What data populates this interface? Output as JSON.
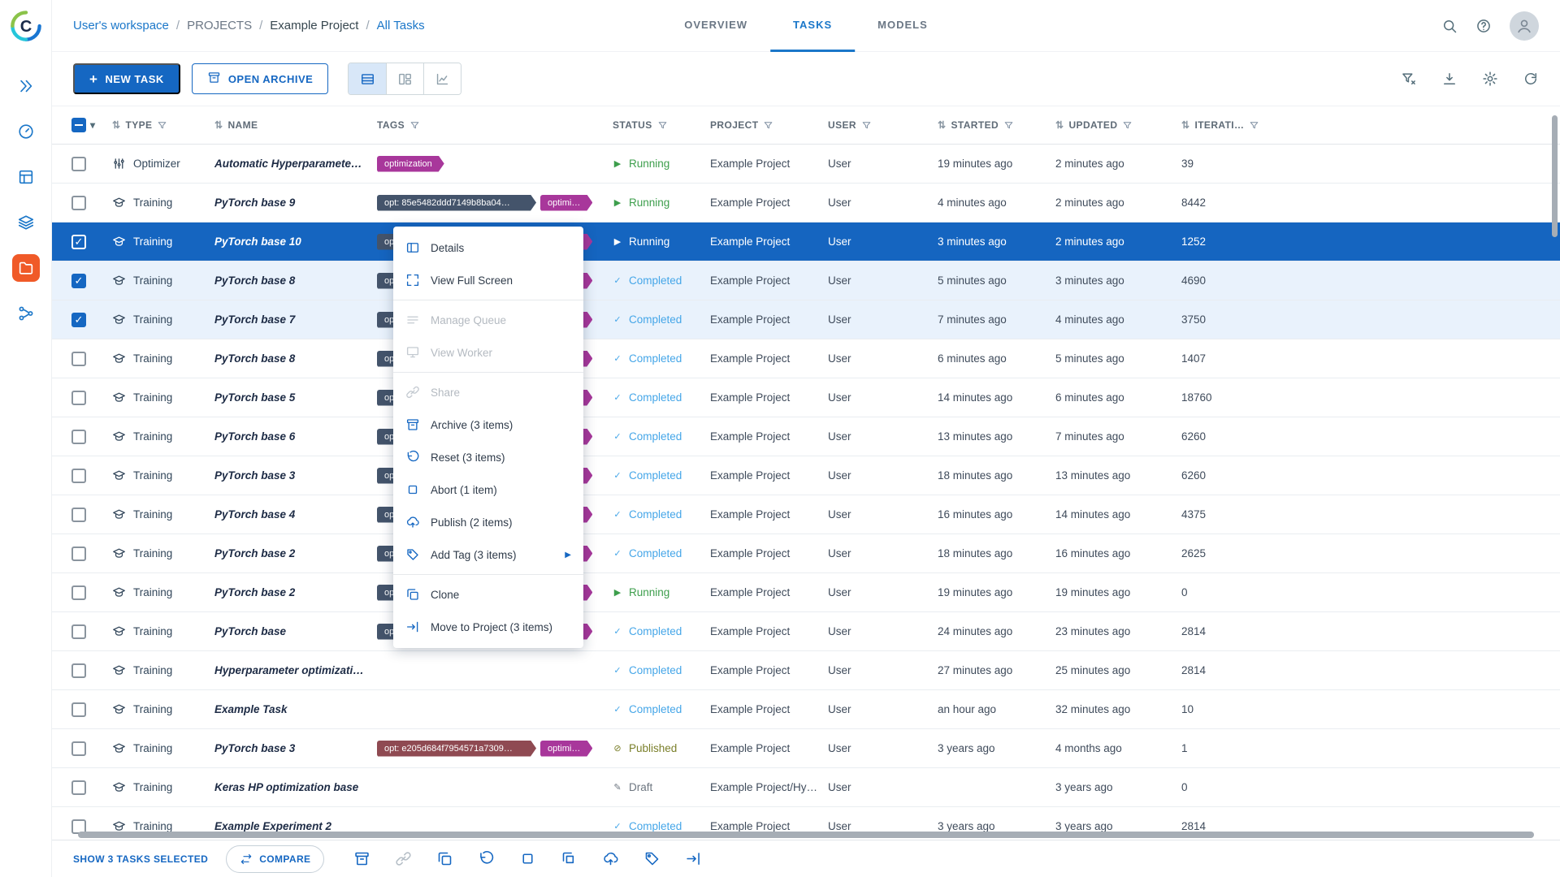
{
  "colors": {
    "primary": "#1567c2",
    "selected_row": "#1565c0",
    "active_nav": "#f05a28",
    "running": "#3d9e4c",
    "completed": "#45a6e8",
    "published": "#7a7f2a",
    "draft": "#6d7680",
    "tag_slate": "#44546b",
    "tag_magenta": "#a8379b",
    "tag_maroon": "#8f4a52"
  },
  "glyphs": {
    "sort": "⇅",
    "caret": "▾",
    "check": "✓",
    "running": "▶",
    "completed": "✓",
    "published": "⊘",
    "draft": "✎",
    "submenu": "▶"
  },
  "breadcrumb": {
    "items": [
      {
        "label": "User's workspace",
        "style": "link"
      },
      {
        "label": "PROJECTS",
        "style": "muted"
      },
      {
        "label": "Example Project",
        "style": "plain"
      },
      {
        "label": "All Tasks",
        "style": "link"
      }
    ],
    "separator": "/"
  },
  "tabs": [
    {
      "label": "OVERVIEW",
      "active": false
    },
    {
      "label": "TASKS",
      "active": true
    },
    {
      "label": "MODELS",
      "active": false
    }
  ],
  "sidebar": {
    "items": [
      {
        "name": "expand",
        "active": false
      },
      {
        "name": "dashboard",
        "active": false
      },
      {
        "name": "reports",
        "active": false
      },
      {
        "name": "datasets",
        "active": false
      },
      {
        "name": "projects",
        "active": true
      },
      {
        "name": "pipelines",
        "active": false
      }
    ]
  },
  "toolbar": {
    "new_task": "NEW TASK",
    "open_archive": "OPEN ARCHIVE",
    "views": [
      {
        "name": "table",
        "active": true
      },
      {
        "name": "cards",
        "active": false
      },
      {
        "name": "chart",
        "active": false
      }
    ],
    "right_icons": [
      {
        "name": "filter"
      },
      {
        "name": "download"
      },
      {
        "name": "settings"
      },
      {
        "name": "auto-refresh"
      }
    ]
  },
  "table": {
    "columns": [
      {
        "label": "TYPE",
        "sort": true,
        "filter": true
      },
      {
        "label": "NAME",
        "sort": true,
        "filter": false
      },
      {
        "label": "TAGS",
        "sort": false,
        "filter": true
      },
      {
        "label": "STATUS",
        "sort": false,
        "filter": true
      },
      {
        "label": "PROJECT",
        "sort": false,
        "filter": true
      },
      {
        "label": "USER",
        "sort": false,
        "filter": true
      },
      {
        "label": "STARTED",
        "sort": true,
        "filter": true
      },
      {
        "label": "UPDATED",
        "sort": true,
        "filter": true
      },
      {
        "label": "ITERATI…",
        "sort": true,
        "filter": true
      }
    ],
    "rows": [
      {
        "type": "Optimizer",
        "icon": "optimizer",
        "name": "Automatic Hyperparamete…",
        "tags": [
          {
            "label": "optimization",
            "color": "magenta",
            "fixed": false
          }
        ],
        "status": "Running",
        "project": "Example Project",
        "user": "User",
        "started": "19 minutes ago",
        "updated": "2 minutes ago",
        "iterations": "39",
        "checked": false,
        "selected": false
      },
      {
        "type": "Training",
        "icon": "training",
        "name": "PyTorch base 9",
        "tags": [
          {
            "label": "opt: 85e5482ddd7149b8ba04…",
            "color": "slate",
            "fixed": true
          },
          {
            "label": "optimi…",
            "color": "magenta",
            "fixed": false
          }
        ],
        "status": "Running",
        "project": "Example Project",
        "user": "User",
        "started": "4 minutes ago",
        "updated": "2 minutes ago",
        "iterations": "8442",
        "checked": false,
        "selected": false
      },
      {
        "type": "Training",
        "icon": "training",
        "name": "PyTorch base 10",
        "tags": [
          {
            "label": "opt: …",
            "color": "slate",
            "fixed": true
          },
          {
            "label": "optimi…",
            "color": "magenta",
            "fixed": false
          }
        ],
        "status": "Running",
        "project": "Example Project",
        "user": "User",
        "started": "3 minutes ago",
        "updated": "2 minutes ago",
        "iterations": "1252",
        "checked": true,
        "selected": true
      },
      {
        "type": "Training",
        "icon": "training",
        "name": "PyTorch base 8",
        "tags": [
          {
            "label": "opt: …",
            "color": "slate",
            "fixed": true
          },
          {
            "label": "optimi…",
            "color": "magenta",
            "fixed": false
          }
        ],
        "status": "Completed",
        "project": "Example Project",
        "user": "User",
        "started": "5 minutes ago",
        "updated": "3 minutes ago",
        "iterations": "4690",
        "checked": true,
        "selected": false
      },
      {
        "type": "Training",
        "icon": "training",
        "name": "PyTorch base 7",
        "tags": [
          {
            "label": "opt: …",
            "color": "slate",
            "fixed": true
          },
          {
            "label": "optimi…",
            "color": "magenta",
            "fixed": false
          }
        ],
        "status": "Completed",
        "project": "Example Project",
        "user": "User",
        "started": "7 minutes ago",
        "updated": "4 minutes ago",
        "iterations": "3750",
        "checked": true,
        "selected": false
      },
      {
        "type": "Training",
        "icon": "training",
        "name": "PyTorch base 8",
        "tags": [
          {
            "label": "opt: …",
            "color": "slate",
            "fixed": true
          },
          {
            "label": "optimi…",
            "color": "magenta",
            "fixed": false
          }
        ],
        "status": "Completed",
        "project": "Example Project",
        "user": "User",
        "started": "6 minutes ago",
        "updated": "5 minutes ago",
        "iterations": "1407",
        "checked": false,
        "selected": false
      },
      {
        "type": "Training",
        "icon": "training",
        "name": "PyTorch base 5",
        "tags": [
          {
            "label": "opt: …",
            "color": "slate",
            "fixed": true
          },
          {
            "label": "optimi…",
            "color": "magenta",
            "fixed": false
          }
        ],
        "status": "Completed",
        "project": "Example Project",
        "user": "User",
        "started": "14 minutes ago",
        "updated": "6 minutes ago",
        "iterations": "18760",
        "checked": false,
        "selected": false
      },
      {
        "type": "Training",
        "icon": "training",
        "name": "PyTorch base 6",
        "tags": [
          {
            "label": "opt: …",
            "color": "slate",
            "fixed": true
          },
          {
            "label": "optimi…",
            "color": "magenta",
            "fixed": false
          }
        ],
        "status": "Completed",
        "project": "Example Project",
        "user": "User",
        "started": "13 minutes ago",
        "updated": "7 minutes ago",
        "iterations": "6260",
        "checked": false,
        "selected": false
      },
      {
        "type": "Training",
        "icon": "training",
        "name": "PyTorch base 3",
        "tags": [
          {
            "label": "opt: …",
            "color": "slate",
            "fixed": true
          },
          {
            "label": "optimi…",
            "color": "magenta",
            "fixed": false
          }
        ],
        "status": "Completed",
        "project": "Example Project",
        "user": "User",
        "started": "18 minutes ago",
        "updated": "13 minutes ago",
        "iterations": "6260",
        "checked": false,
        "selected": false
      },
      {
        "type": "Training",
        "icon": "training",
        "name": "PyTorch base 4",
        "tags": [
          {
            "label": "opt: …",
            "color": "slate",
            "fixed": true
          },
          {
            "label": "optimi…",
            "color": "magenta",
            "fixed": false
          }
        ],
        "status": "Completed",
        "project": "Example Project",
        "user": "User",
        "started": "16 minutes ago",
        "updated": "14 minutes ago",
        "iterations": "4375",
        "checked": false,
        "selected": false
      },
      {
        "type": "Training",
        "icon": "training",
        "name": "PyTorch base 2",
        "tags": [
          {
            "label": "opt: …",
            "color": "slate",
            "fixed": true
          },
          {
            "label": "optimi…",
            "color": "magenta",
            "fixed": false
          }
        ],
        "status": "Completed",
        "project": "Example Project",
        "user": "User",
        "started": "18 minutes ago",
        "updated": "16 minutes ago",
        "iterations": "2625",
        "checked": false,
        "selected": false
      },
      {
        "type": "Training",
        "icon": "training",
        "name": "PyTorch base 2",
        "tags": [
          {
            "label": "opt: …",
            "color": "slate",
            "fixed": true
          },
          {
            "label": "optimi…",
            "color": "magenta",
            "fixed": false
          }
        ],
        "status": "Running",
        "project": "Example Project",
        "user": "User",
        "started": "19 minutes ago",
        "updated": "19 minutes ago",
        "iterations": "0",
        "checked": false,
        "selected": false
      },
      {
        "type": "Training",
        "icon": "training",
        "name": "PyTorch base",
        "tags": [
          {
            "label": "opt: …",
            "color": "slate",
            "fixed": true
          },
          {
            "label": "optimi…",
            "color": "magenta",
            "fixed": false
          }
        ],
        "status": "Completed",
        "project": "Example Project",
        "user": "User",
        "started": "24 minutes ago",
        "updated": "23 minutes ago",
        "iterations": "2814",
        "checked": false,
        "selected": false
      },
      {
        "type": "Training",
        "icon": "training",
        "name": "Hyperparameter optimizati…",
        "tags": [],
        "status": "Completed",
        "project": "Example Project",
        "user": "User",
        "started": "27 minutes ago",
        "updated": "25 minutes ago",
        "iterations": "2814",
        "checked": false,
        "selected": false
      },
      {
        "type": "Training",
        "icon": "training",
        "name": "Example Task",
        "tags": [],
        "status": "Completed",
        "project": "Example Project",
        "user": "User",
        "started": "an hour ago",
        "updated": "32 minutes ago",
        "iterations": "10",
        "checked": false,
        "selected": false
      },
      {
        "type": "Training",
        "icon": "training",
        "name": "PyTorch base 3",
        "tags": [
          {
            "label": "opt: e205d684f7954571a7309…",
            "color": "maroon",
            "fixed": true
          },
          {
            "label": "optimi…",
            "color": "magenta",
            "fixed": false
          }
        ],
        "status": "Published",
        "project": "Example Project",
        "user": "User",
        "started": "3 years ago",
        "updated": "4 months ago",
        "iterations": "1",
        "checked": false,
        "selected": false
      },
      {
        "type": "Training",
        "icon": "training",
        "name": "Keras HP optimization base",
        "tags": [],
        "status": "Draft",
        "project": "Example Project/Hy…",
        "user": "User",
        "started": "",
        "updated": "3 years ago",
        "iterations": "0",
        "checked": false,
        "selected": false
      },
      {
        "type": "Training",
        "icon": "training",
        "name": "Example Experiment 2",
        "tags": [],
        "status": "Completed",
        "project": "Example Project",
        "user": "User",
        "started": "3 years ago",
        "updated": "3 years ago",
        "iterations": "2814",
        "checked": false,
        "selected": false
      }
    ]
  },
  "context_menu": {
    "items": [
      {
        "label": "Details",
        "icon": "details",
        "disabled": false,
        "submenu": false
      },
      {
        "label": "View Full Screen",
        "icon": "fullscreen",
        "disabled": false,
        "submenu": false
      },
      {
        "divider": true
      },
      {
        "label": "Manage Queue",
        "icon": "queue",
        "disabled": true,
        "submenu": false
      },
      {
        "label": "View Worker",
        "icon": "worker",
        "disabled": true,
        "submenu": false
      },
      {
        "divider": true
      },
      {
        "label": "Share",
        "icon": "share",
        "disabled": true,
        "submenu": false
      },
      {
        "label": "Archive (3 items)",
        "icon": "archive",
        "disabled": false,
        "submenu": false
      },
      {
        "label": "Reset (3 items)",
        "icon": "reset",
        "disabled": false,
        "submenu": false
      },
      {
        "label": "Abort (1 item)",
        "icon": "abort",
        "disabled": false,
        "submenu": false
      },
      {
        "label": "Publish (2 items)",
        "icon": "publish",
        "disabled": false,
        "submenu": false
      },
      {
        "label": "Add Tag (3 items)",
        "icon": "tag",
        "disabled": false,
        "submenu": true
      },
      {
        "divider": true
      },
      {
        "label": "Clone",
        "icon": "clone",
        "disabled": false,
        "submenu": false
      },
      {
        "label": "Move to Project (3 items)",
        "icon": "move",
        "disabled": false,
        "submenu": false
      }
    ]
  },
  "footer": {
    "selected_text": "SHOW 3 TASKS SELECTED",
    "compare_label": "COMPARE",
    "actions": [
      {
        "name": "archive",
        "disabled": false
      },
      {
        "name": "share",
        "disabled": true
      },
      {
        "name": "clone",
        "disabled": false
      },
      {
        "name": "reset",
        "disabled": false
      },
      {
        "name": "abort",
        "disabled": false
      },
      {
        "name": "abortall",
        "disabled": false
      },
      {
        "name": "publish",
        "disabled": false
      },
      {
        "name": "tag",
        "disabled": false
      },
      {
        "name": "move",
        "disabled": false
      }
    ]
  }
}
